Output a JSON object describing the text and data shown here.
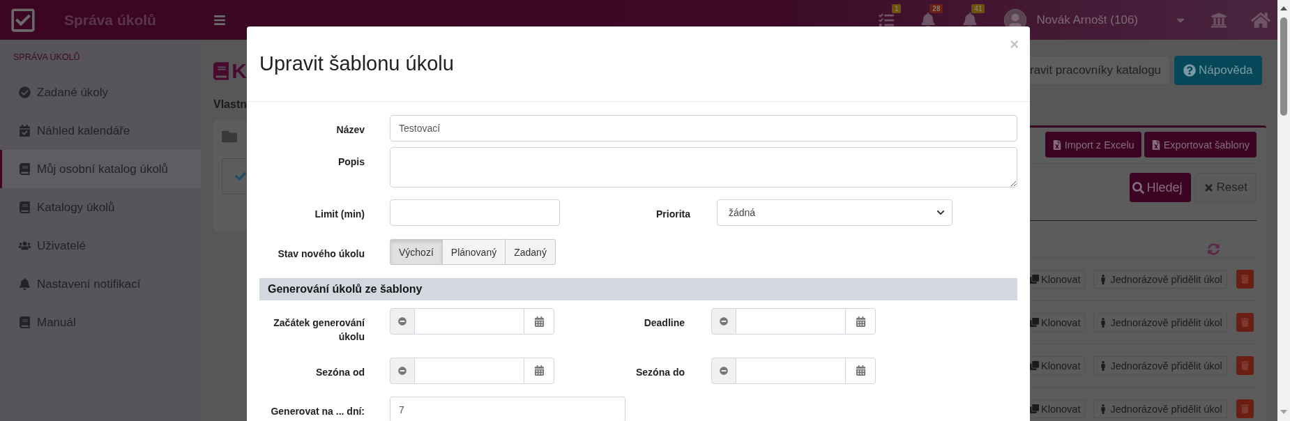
{
  "topbar": {
    "app_title": "Správa úkolů",
    "notifications": [
      {
        "badge": "1",
        "color": "#6e5306"
      },
      {
        "badge": "28",
        "color": "#6b1f14"
      },
      {
        "badge": "41",
        "color": "#6e5306"
      }
    ],
    "user_name": "Novák Arnošt (106)"
  },
  "sidebar": {
    "heading": "SPRÁVA ÚKOLŮ",
    "items": [
      {
        "label": "Zadané úkoly",
        "selected": false
      },
      {
        "label": "Náhled kalendáře",
        "selected": false
      },
      {
        "label": "Můj osobní katalog úkolů",
        "selected": true
      },
      {
        "label": "Katalogy úkolů",
        "selected": false
      },
      {
        "label": "Uživatelé",
        "selected": false
      },
      {
        "label": "Nastavení notifikací",
        "selected": false
      },
      {
        "label": "Manuál",
        "selected": false
      }
    ]
  },
  "page": {
    "heading": "K",
    "section_title": "Vlastn",
    "header_buttons": [
      {
        "label": "ravit pracovníky katalogu",
        "kind": "default"
      },
      {
        "label": "Nápověda",
        "kind": "help"
      }
    ],
    "toolbar_buttons": [
      "Import z Excelu",
      "Exportovat šablony"
    ],
    "search_button": "Hledej",
    "reset_button": "Reset",
    "rows": [
      {
        "clone_button": "Klonovat",
        "assign_button": "Jednorázově přidělit úkol"
      },
      {
        "clone_button": "Klonovat",
        "assign_button": "Jednorázově přidělit úkol"
      },
      {
        "clone_button": "Klonovat",
        "assign_button": "Jednorázově přidělit úkol"
      },
      {
        "clone_button": "Klonovat",
        "assign_button": "Jednorázově přidělit úkol"
      }
    ]
  },
  "modal": {
    "title": "Upravit šablonu úkolu",
    "close": "×",
    "name": {
      "label": "Název",
      "value": "Testovací"
    },
    "description": {
      "label": "Popis"
    },
    "limit": {
      "label": "Limit (min)"
    },
    "priority": {
      "label": "Priorita",
      "value": "žádná"
    },
    "state": {
      "label": "Stav nového úkolu",
      "options": [
        {
          "label": "Výchozí",
          "selected": true
        },
        {
          "label": "Plánovaný",
          "selected": false
        },
        {
          "label": "Zadaný",
          "selected": false
        }
      ]
    },
    "generation": {
      "title": "Generování úkolů ze šablony",
      "date_fields": [
        {
          "label": "Začátek generování úkolu"
        },
        {
          "label": "Deadline"
        },
        {
          "label": "Sezóna od"
        },
        {
          "label": "Sezóna do"
        }
      ],
      "days": {
        "label": "Generovat na ... dní:",
        "value": "7"
      }
    }
  }
}
